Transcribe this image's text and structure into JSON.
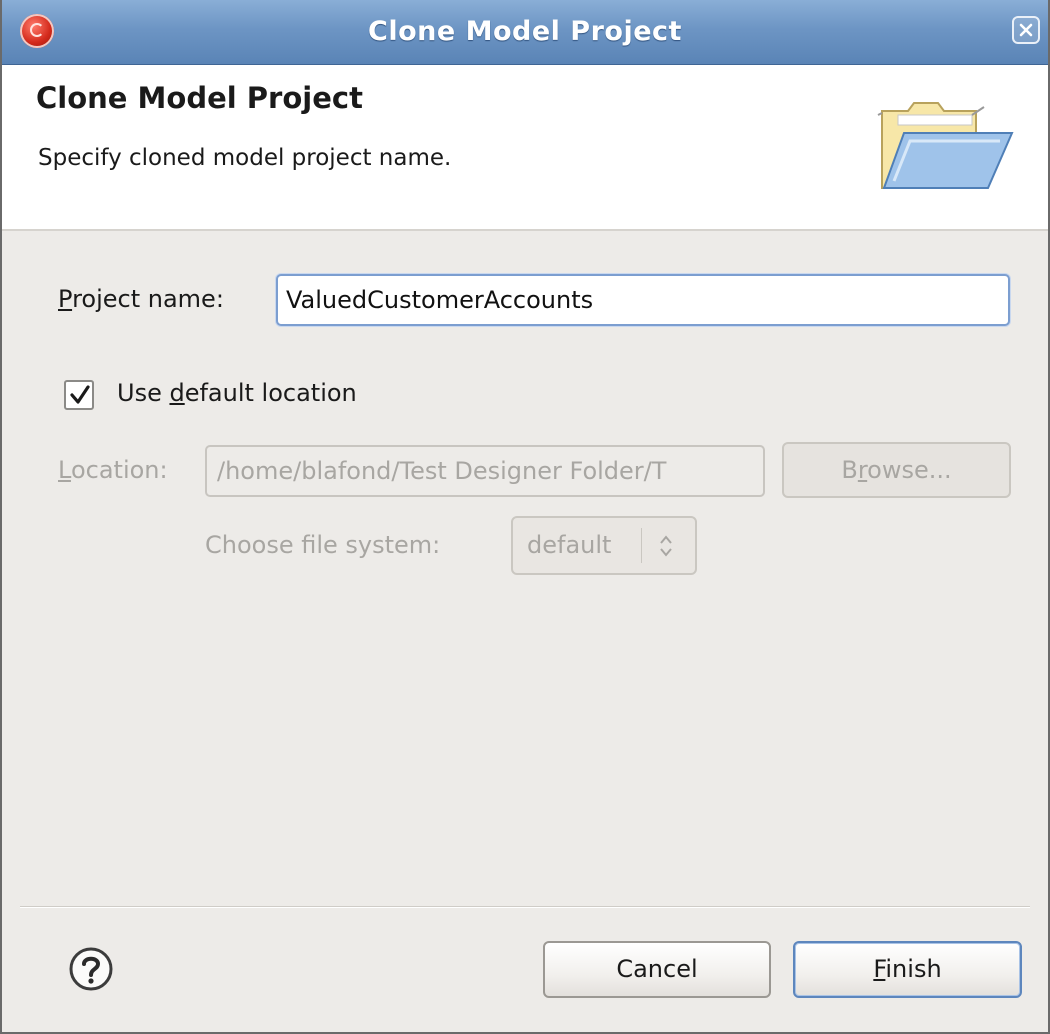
{
  "window": {
    "title": "Clone Model Project",
    "icons": {
      "app": "app-logo-icon",
      "close": "close-icon"
    }
  },
  "header": {
    "title": "Clone Model Project",
    "description": "Specify cloned model project name.",
    "icon": "open-folder-icon"
  },
  "form": {
    "project_name": {
      "label_mnemonic": "P",
      "label_rest": "roject name:",
      "value": "ValuedCustomerAccounts"
    },
    "use_default_location": {
      "label_before": "Use ",
      "label_mnemonic": "d",
      "label_after": "efault location",
      "checked": true
    },
    "location": {
      "label_mnemonic": "L",
      "label_rest": "ocation:",
      "value": "/home/blafond/Test Designer Folder/T",
      "enabled": false
    },
    "browse": {
      "label_before": "B",
      "label_mnemonic": "r",
      "label_after": "owse...",
      "enabled": false
    },
    "file_system": {
      "label": "Choose file system:",
      "selected": "default",
      "enabled": false
    }
  },
  "footer": {
    "help_icon": "help-icon",
    "cancel_label": "Cancel",
    "finish_mnemonic": "F",
    "finish_rest": "inish"
  },
  "colors": {
    "titlebar": "#6d95c4",
    "dialog_bg": "#edebe8",
    "disabled_text": "#a8a6a2",
    "focus_border": "#7c9ed0"
  }
}
